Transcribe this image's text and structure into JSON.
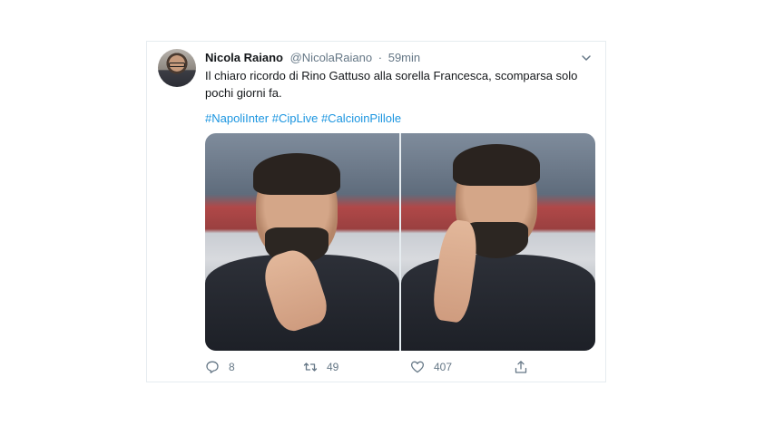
{
  "tweet": {
    "author_name": "Nicola Raiano",
    "author_handle": "@NicolaRaiano",
    "separator": "·",
    "time": "59min",
    "text": "Il chiaro ricordo di Rino Gattuso alla sorella Francesca, scomparsa solo pochi giorni fa.",
    "hashtags": [
      "#NapoliInter",
      "#CipLive",
      "#CalcioinPillole"
    ],
    "media_count": 2,
    "actions": {
      "reply_icon": "reply-icon",
      "reply_count": "8",
      "retweet_icon": "retweet-icon",
      "retweet_count": "49",
      "like_icon": "heart-icon",
      "like_count": "407",
      "share_icon": "share-icon"
    },
    "colors": {
      "link": "#1b95e0",
      "text": "#14171a",
      "muted": "#657786",
      "border": "#e6ecf0"
    }
  }
}
